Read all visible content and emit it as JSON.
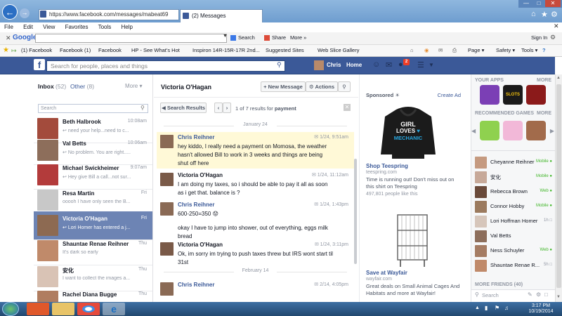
{
  "browser": {
    "address": "https://www.facebook.com/messages/mabeat69",
    "tab_title": "(2) Messages",
    "menu": [
      "File",
      "Edit",
      "View",
      "Favorites",
      "Tools",
      "Help"
    ],
    "google_label": "Google",
    "search_label": "Search",
    "share_label": "Share",
    "more_label": "More »",
    "signin_label": "Sign In",
    "favorites": [
      "(1) Facebook",
      "Facebook (1)",
      "Facebook",
      "HP - See What's Hot",
      "Inspiron 14R-15R-17R 2nd...",
      "Suggested Sites",
      "Web Slice Gallery"
    ],
    "cmd_page": "Page",
    "cmd_safety": "Safety",
    "cmd_tools": "Tools"
  },
  "facebook": {
    "search_placeholder": "Search for people, places and things",
    "user_name": "Chris",
    "home_label": "Home",
    "notif_count": "2"
  },
  "inbox": {
    "title": "Inbox",
    "count": "(52)",
    "other_label": "Other",
    "other_count": "(8)",
    "more_label": "More",
    "search_placeholder": "Search",
    "threads": [
      {
        "name": "Beth Halbrook",
        "time": "10:08am",
        "snippet": "need your help...need to c..."
      },
      {
        "name": "Val Betts",
        "time": "10:06am",
        "snippet": "No problem. You are right....."
      },
      {
        "name": "Michael Swickheimer",
        "time": "9:07am",
        "snippet": "Hey give Bill a call...not sur..."
      },
      {
        "name": "Resa Martin",
        "time": "Fri",
        "snippet": "ooooh I have only seen the B..."
      },
      {
        "name": "Victoria O'Hagan",
        "time": "Fri",
        "snippet": "Lori Homer has entered a j..."
      },
      {
        "name": "Shauntae Renae Reihner",
        "time": "Thu",
        "snippet": "It's dark so early"
      },
      {
        "name": "安化",
        "time": "Thu",
        "snippet": "I want to collect the images a..."
      },
      {
        "name": "Rachel Diana Bugge",
        "time": "Thu",
        "snippet": ""
      }
    ]
  },
  "conversation": {
    "title": "Victoria O'Hagan",
    "new_message_label": "New Message",
    "actions_label": "Actions",
    "search_results_label": "Search Results",
    "results_text": "1 of 7 results for",
    "results_query": "payment",
    "date1": "January 24",
    "date2": "February 14",
    "messages": [
      {
        "author": "Chris Reihner",
        "time": "1/24, 9:51am",
        "body": "hey kiddo, I really need a payment on Momosa, the weather hasn't allowed Bill to work in 3 weeks and things are being shut off here"
      },
      {
        "author": "Victoria O'Hagan",
        "time": "1/24, 11:12am",
        "body": "I am doing my taxes, so i should be able to pay it all as soon as i get that. balance is ?"
      },
      {
        "author": "Chris Reihner",
        "time": "1/24, 1:43pm",
        "body": "600-250=350 😟"
      },
      {
        "author": "",
        "time": "",
        "body": "okay I have to jump into shower, out of everything, eggs milk bread"
      },
      {
        "author": "Victoria O'Hagan",
        "time": "1/24, 3:11pm",
        "body": "Ok, im sorry im trying to push taxes threw but IRS wont start til 31st"
      },
      {
        "author": "Chris Reihner",
        "time": "2/14, 4:05pm",
        "body": ""
      }
    ]
  },
  "ads": {
    "sponsored_label": "Sponsored",
    "create_ad_label": "Create Ad",
    "shirt_line1": "GIRL",
    "shirt_line2": "LOVES",
    "shirt_line3": "MECHANIC",
    "ad1_title": "Shop Teespring",
    "ad1_domain": "teespring.com",
    "ad1_body": "Time is running out! Don't miss out on this shirt on Teespring",
    "ad1_likes": "497,801 people like this",
    "ad2_title": "Save at Wayfair",
    "ad2_domain": "wayfair.com",
    "ad2_body": "Great deals on Small Animal Cages And Habitats and more at Wayfair!"
  },
  "sidebar": {
    "your_apps_label": "YOUR APPS",
    "more_label": "MORE",
    "recommended_games_label": "RECOMMENDED GAMES",
    "slots_label": "SLOTS",
    "more_friends_label": "MORE FRIENDS (40)",
    "search_placeholder": "Search",
    "friends": [
      {
        "name": "Cheyanne Reihner",
        "status": "Mobile"
      },
      {
        "name": "安化",
        "status": "Mobile"
      },
      {
        "name": "Rebecca Brown",
        "status": "Web"
      },
      {
        "name": "Connor Hobby",
        "status": "Mobile"
      },
      {
        "name": "Lori Hoffman Homer",
        "status": "1h"
      },
      {
        "name": "Val Betts",
        "status": ""
      },
      {
        "name": "Ness Schuyler",
        "status": "Web"
      },
      {
        "name": "Shauntae Renae R...",
        "status": "5h"
      }
    ]
  },
  "taskbar": {
    "time": "3:17 PM",
    "date": "10/19/2014"
  },
  "colors": {
    "facebook_blue": "#3b5998",
    "selected_thread": "#6d84b4",
    "highlight_message": "#fff9d7",
    "online_green": "#42b72a"
  }
}
